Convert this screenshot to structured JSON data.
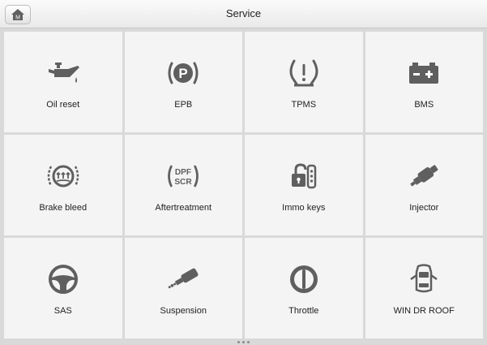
{
  "header": {
    "title": "Service",
    "home_badge": "M"
  },
  "tiles": [
    {
      "label": "Oil reset",
      "icon": "oil-can-icon"
    },
    {
      "label": "EPB",
      "icon": "parking-brake-icon"
    },
    {
      "label": "TPMS",
      "icon": "tire-pressure-icon"
    },
    {
      "label": "BMS",
      "icon": "battery-icon"
    },
    {
      "label": "Brake bleed",
      "icon": "brake-bleed-icon"
    },
    {
      "label": "Aftertreatment",
      "icon": "dpf-scr-icon",
      "icon_text": [
        "DPF",
        "SCR"
      ]
    },
    {
      "label": "Immo keys",
      "icon": "immobilizer-key-icon"
    },
    {
      "label": "Injector",
      "icon": "injector-icon"
    },
    {
      "label": "SAS",
      "icon": "steering-wheel-icon"
    },
    {
      "label": "Suspension",
      "icon": "suspension-shock-icon"
    },
    {
      "label": "Throttle",
      "icon": "throttle-body-icon"
    },
    {
      "label": "WIN DR ROOF",
      "icon": "car-doors-icon"
    }
  ],
  "colors": {
    "icon": "#5f5f5f",
    "tile_bg": "#f4f4f4",
    "page_bg": "#d9d9d9"
  }
}
